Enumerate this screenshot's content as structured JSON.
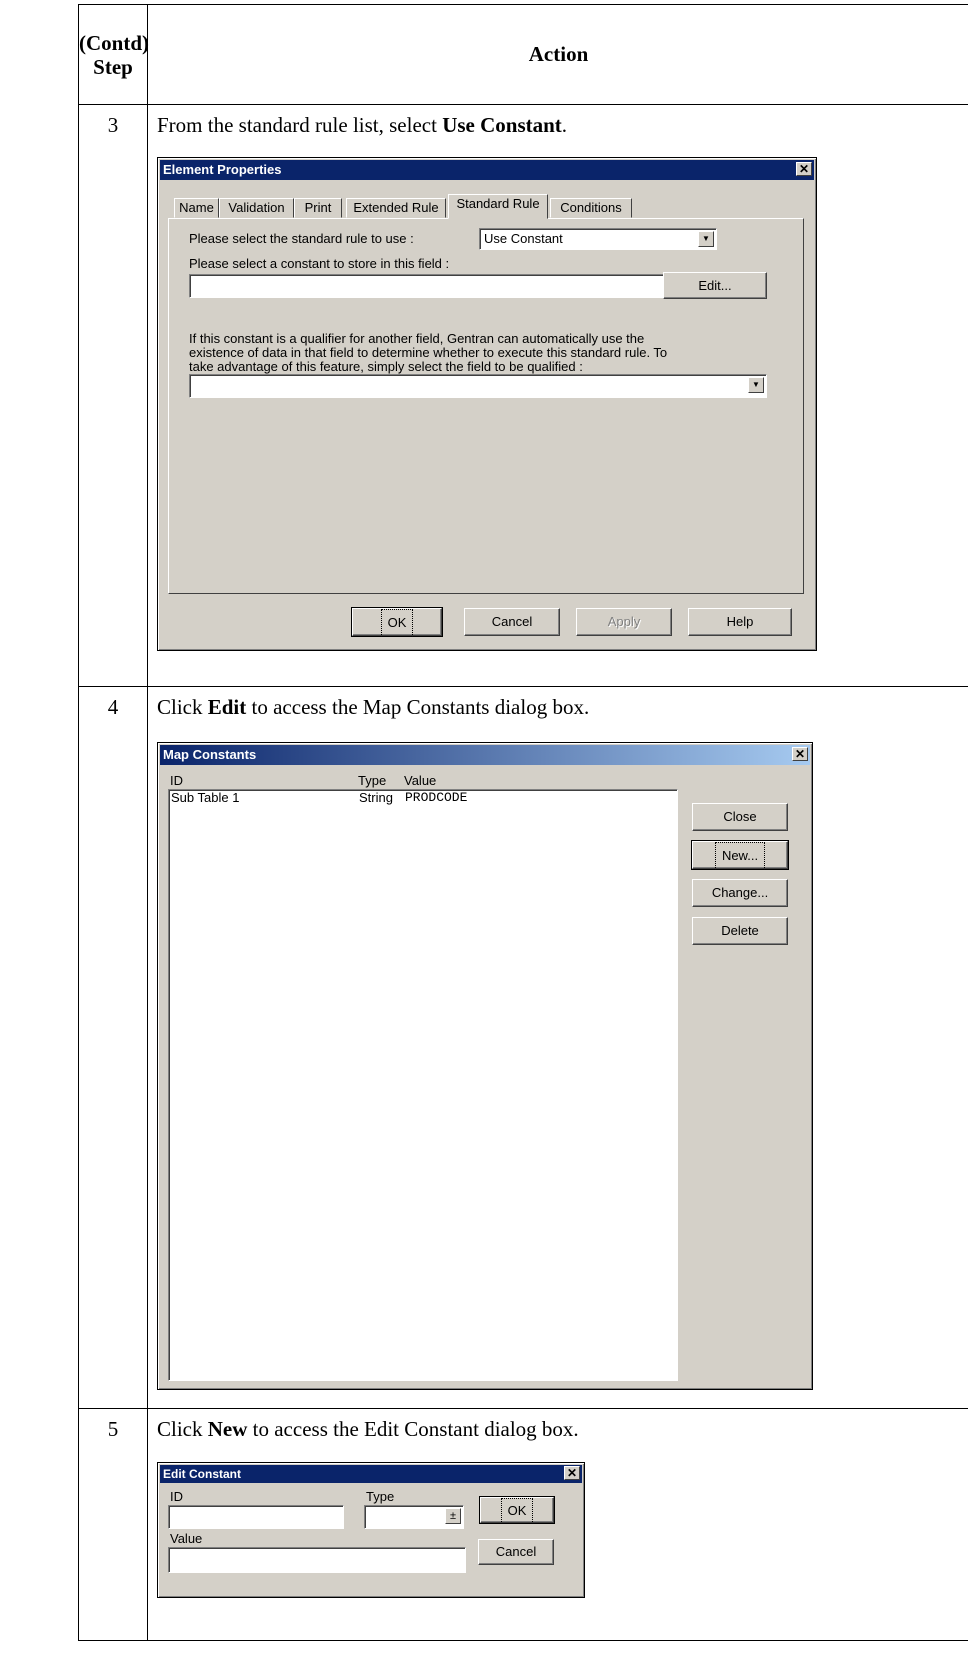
{
  "header": {
    "step_line1": "(Contd)",
    "step_line2": "Step",
    "action": "Action"
  },
  "steps": [
    {
      "number": "3",
      "text_before": "From the standard rule list, select ",
      "bold": "Use Constant",
      "text_after": "."
    },
    {
      "number": "4",
      "text_before": "Click ",
      "bold": "Edit",
      "text_after": " to access the Map Constants dialog box."
    },
    {
      "number": "5",
      "text_before": "Click ",
      "bold": "New",
      "text_after": " to access the Edit Constant dialog box."
    }
  ],
  "element_properties": {
    "title": "Element Properties",
    "tabs": [
      "Name",
      "Validation",
      "Print",
      "Extended Rule",
      "Standard Rule",
      "Conditions"
    ],
    "active_tab": "Standard Rule",
    "rule_label": "Please select the standard rule to use :",
    "rule_value": "Use Constant",
    "constant_label": "Please select a constant to store in this field :",
    "constant_value": "",
    "edit_button": "Edit...",
    "qualifier_text_1": "If this constant is a qualifier for another field,  Gentran can automatically use the",
    "qualifier_text_2": "existence of data in that field to determine whether to execute this standard rule. To",
    "qualifier_text_3": "take advantage of this feature, simply select the field to be qualified :",
    "qualifier_value": "",
    "buttons": {
      "ok": "OK",
      "cancel": "Cancel",
      "apply": "Apply",
      "help": "Help"
    }
  },
  "map_constants": {
    "title": "Map Constants",
    "columns": [
      "ID",
      "Type",
      "Value"
    ],
    "rows": [
      {
        "id": "Sub Table 1",
        "type": "String",
        "value": "PRODCODE"
      }
    ],
    "buttons": {
      "close": "Close",
      "new": "New...",
      "change": "Change...",
      "delete": "Delete"
    }
  },
  "edit_constant": {
    "title": "Edit Constant",
    "id_label": "ID",
    "type_label": "Type",
    "value_label": "Value",
    "id_value": "",
    "type_value": "",
    "value_value": "",
    "buttons": {
      "ok": "OK",
      "cancel": "Cancel"
    }
  }
}
